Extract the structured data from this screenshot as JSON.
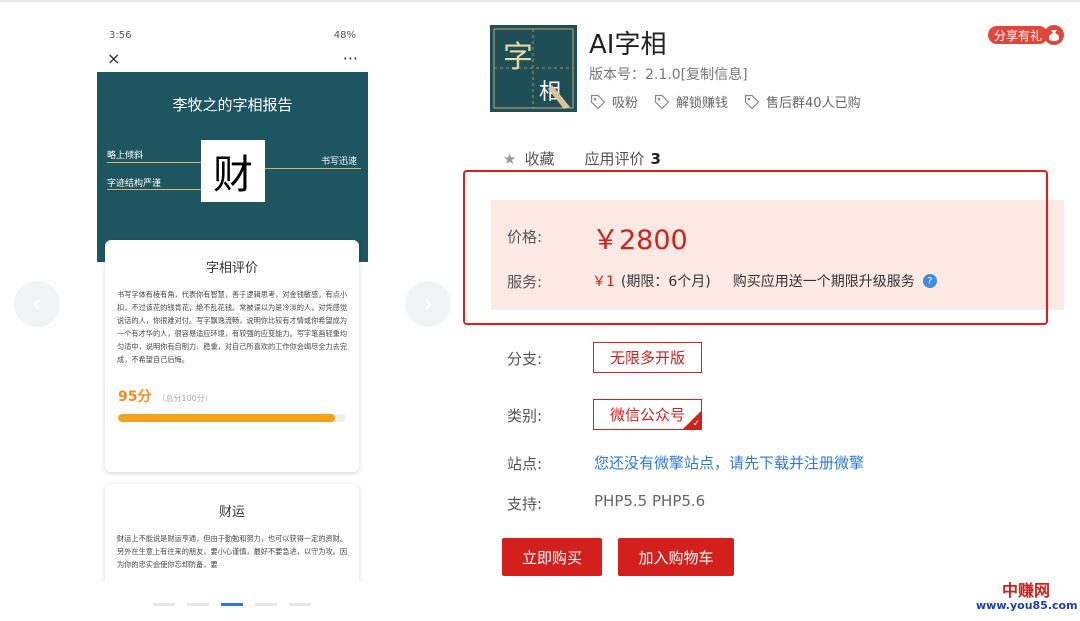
{
  "gallery": {
    "prev_arrow": "‹",
    "next_arrow": "›",
    "phone": {
      "status_time": "3:56",
      "status_right": "48%",
      "close_icon": "×",
      "more_icon": "···",
      "hero_title": "李牧之的字相报告",
      "hero_char": "财",
      "labels": [
        "略上倾斜",
        "字迹结构严谨",
        "书写迅速"
      ],
      "card1": {
        "title": "字相评价",
        "body": "书写字体有棱有角，代表你有智慧，善于逻辑思考，对金钱敏感，有点小扣，不过该花的钱肯花，绝不乱花钱。常被误以为是冷淡的人，对凭感觉说话的人，你很难对付。写字飘逸流畅，说明你比较有才情或你希望成为一个有才华的人，很容易适应环境，有较强的应变能力。写字笔画轻重均匀适中，说明你有自制力、稳重，对自己所喜欢的工作你会竭尽全力去完成，不希望自己后悔。",
        "score": "95分",
        "score_note": "（总分100分）",
        "score_fraction": 0.95
      },
      "card2": {
        "title": "财运",
        "body": "财运上不能说是财运亨通，但由于勤勉和努力，也可以获得一定的资财。另外在生意上有往来的朋友，要小心谨慎，最好不要急进，以守为攻。因为你的忠实会使你忘却防备，要"
      }
    },
    "dots_active_index": 2
  },
  "app": {
    "icon_chars": [
      "字",
      "相"
    ],
    "title": "AI字相",
    "version": "版本号：2.1.0[复制信息]",
    "tags": [
      "吸粉",
      "解锁赚钱",
      "售后群40人已购"
    ],
    "share_label": "分享有礼"
  },
  "meta": {
    "favorite_label": "收藏",
    "review_label": "应用评价",
    "review_count": "3"
  },
  "pricing": {
    "price_label": "价格:",
    "price": "￥2800",
    "service_label": "服务:",
    "service_amount": "￥1",
    "service_period": "(期限：6个月)",
    "service_note": "购买应用送一个期限升级服务"
  },
  "options": {
    "branch_label": "分支:",
    "branch_value": "无限多开版",
    "category_label": "类别:",
    "category_value": "微信公众号",
    "site_label": "站点:",
    "site_link": "您还没有微擎站点，请先下载并注册微擎",
    "support_label": "支持:",
    "support_value": "PHP5.5  PHP5.6"
  },
  "actions": {
    "buy_label": "立即购买",
    "cart_label": "加入购物车"
  },
  "watermark": {
    "cn": "中赚网",
    "url": "www.you85.com"
  },
  "colors": {
    "accent_red": "#d3201c",
    "price_bg": "#fde9e4",
    "link_blue": "#2e7bd6",
    "hero_teal": "#1d5560"
  }
}
